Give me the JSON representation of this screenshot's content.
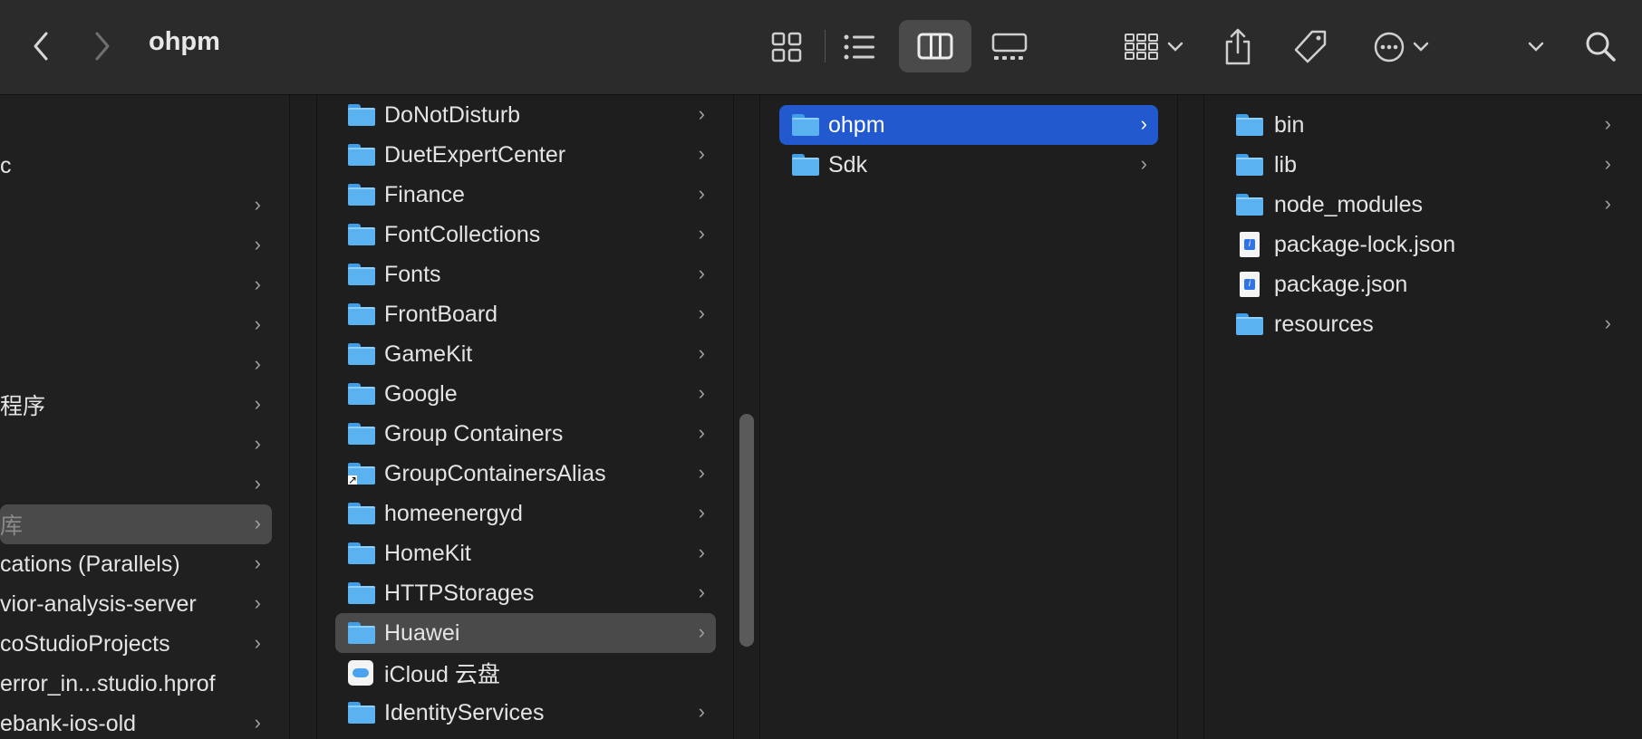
{
  "window": {
    "title": "ohpm"
  },
  "toolbar": {
    "back": "‹",
    "forward": "›",
    "icons": [
      "icon-view-icon",
      "list-view-icon",
      "column-view-icon",
      "gallery-view-icon",
      "group-by-icon",
      "share-icon",
      "tag-icon",
      "more-actions-icon",
      "expand-icon",
      "search-icon"
    ]
  },
  "sidebar": {
    "items": [
      {
        "label": "c",
        "chevron": false
      },
      {
        "label": "",
        "chevron": true
      },
      {
        "label": "",
        "chevron": true
      },
      {
        "label": "",
        "chevron": true
      },
      {
        "label": "",
        "chevron": true
      },
      {
        "label": "",
        "chevron": true
      },
      {
        "label": "程序",
        "chevron": true
      },
      {
        "label": "",
        "chevron": true
      },
      {
        "label": "",
        "chevron": true
      },
      {
        "label": "库",
        "chevron": true
      },
      {
        "label": "cations (Parallels)",
        "chevron": true
      },
      {
        "label": "vior-analysis-server",
        "chevron": true
      },
      {
        "label": "coStudioProjects",
        "chevron": true
      },
      {
        "label": "error_in...studio.hprof",
        "chevron": false
      },
      {
        "label": "ebank-ios-old",
        "chevron": true
      }
    ]
  },
  "column1": {
    "items": [
      {
        "label": "DoNotDisturb",
        "icon": "folder"
      },
      {
        "label": "DuetExpertCenter",
        "icon": "folder"
      },
      {
        "label": "Finance",
        "icon": "folder"
      },
      {
        "label": "FontCollections",
        "icon": "folder"
      },
      {
        "label": "Fonts",
        "icon": "folder"
      },
      {
        "label": "FrontBoard",
        "icon": "folder"
      },
      {
        "label": "GameKit",
        "icon": "folder"
      },
      {
        "label": "Google",
        "icon": "folder"
      },
      {
        "label": "Group Containers",
        "icon": "folder"
      },
      {
        "label": "GroupContainersAlias",
        "icon": "alias"
      },
      {
        "label": "homeenergyd",
        "icon": "folder"
      },
      {
        "label": "HomeKit",
        "icon": "folder"
      },
      {
        "label": "HTTPStorages",
        "icon": "folder"
      },
      {
        "label": "Huawei",
        "icon": "folder"
      },
      {
        "label": "iCloud 云盘",
        "icon": "icloud"
      },
      {
        "label": "IdentityServices",
        "icon": "folder"
      }
    ]
  },
  "column2": {
    "items": [
      {
        "label": "ohpm",
        "icon": "folder"
      },
      {
        "label": "Sdk",
        "icon": "folder"
      }
    ]
  },
  "column3": {
    "items": [
      {
        "label": "bin",
        "icon": "folder"
      },
      {
        "label": "lib",
        "icon": "folder"
      },
      {
        "label": "node_modules",
        "icon": "folder"
      },
      {
        "label": "package-lock.json",
        "icon": "file"
      },
      {
        "label": "package.json",
        "icon": "file"
      },
      {
        "label": "resources",
        "icon": "folder"
      }
    ]
  }
}
